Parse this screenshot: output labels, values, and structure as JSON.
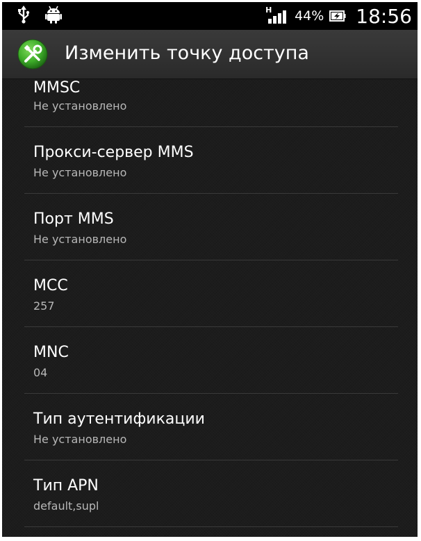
{
  "status_bar": {
    "network_type": "H",
    "battery_percent": "44%",
    "time": "18:56",
    "icons": [
      "usb-icon",
      "android-debug-icon",
      "signal-icon",
      "battery-charging-icon"
    ]
  },
  "header": {
    "title": "Изменить точку доступа",
    "icon": "settings-tools-icon",
    "icon_color": "#3fae2a"
  },
  "settings": {
    "items": [
      {
        "title": "MMSC",
        "summary": "Не установлено"
      },
      {
        "title": "Прокси-сервер MMS",
        "summary": "Не установлено"
      },
      {
        "title": "Порт MMS",
        "summary": "Не установлено"
      },
      {
        "title": "MCC",
        "summary": "257"
      },
      {
        "title": "MNC",
        "summary": "04"
      },
      {
        "title": "Тип аутентификации",
        "summary": "Не установлено"
      },
      {
        "title": "Тип APN",
        "summary": "default,supl"
      }
    ]
  }
}
